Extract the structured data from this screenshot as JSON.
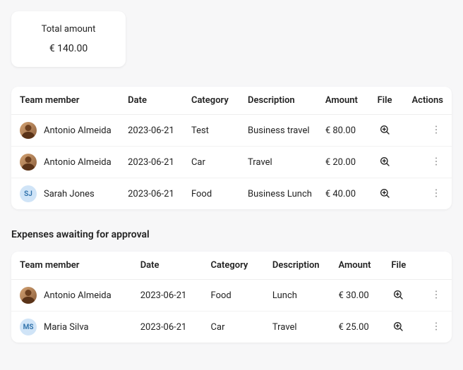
{
  "total": {
    "label": "Total amount",
    "value": "€ 140.00"
  },
  "table1": {
    "headers": {
      "member": "Team member",
      "date": "Date",
      "category": "Category",
      "description": "Description",
      "amount": "Amount",
      "file": "File",
      "actions": "Actions"
    },
    "rows": [
      {
        "member": "Antonio Almeida",
        "avatarType": "img",
        "date": "2023-06-21",
        "category": "Test",
        "description": "Business travel",
        "amount": "€ 80.00"
      },
      {
        "member": "Antonio Almeida",
        "avatarType": "img",
        "date": "2023-06-21",
        "category": "Car",
        "description": "Travel",
        "amount": "€ 20.00"
      },
      {
        "member": "Sarah Jones",
        "avatarType": "sj",
        "initials": "SJ",
        "date": "2023-06-21",
        "category": "Food",
        "description": "Business Lunch",
        "amount": "€ 40.00"
      }
    ]
  },
  "section2": {
    "title": "Expenses awaiting for approval"
  },
  "table2": {
    "headers": {
      "member": "Team member",
      "date": "Date",
      "category": "Category",
      "description": "Description",
      "amount": "Amount",
      "file": "File"
    },
    "rows": [
      {
        "member": "Antonio Almeida",
        "avatarType": "img",
        "date": "2023-06-21",
        "category": "Food",
        "description": "Lunch",
        "amount": "€ 30.00"
      },
      {
        "member": "Maria Silva",
        "avatarType": "ms",
        "initials": "MS",
        "date": "2023-06-21",
        "category": "Car",
        "description": "Travel",
        "amount": "€ 25.00"
      }
    ]
  }
}
